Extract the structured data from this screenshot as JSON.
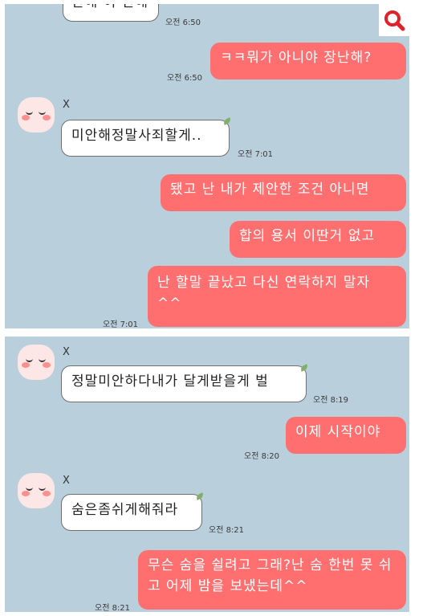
{
  "panel1": {
    "top_partial_message": "안해 이 안해",
    "top_partial_time": "오전 6:50",
    "msg1": {
      "text": "ㅋㅋ뭐가 아니야 장난해?",
      "time": "오전 6:50"
    },
    "sender": "X",
    "msg2": {
      "text": "미안해정말사죄할게..",
      "time": "오전 7:01"
    },
    "msg3": {
      "text": "됐고 난 내가 제안한 조건 아니면"
    },
    "msg4": {
      "text": "합의 용서 이딴거 없고"
    },
    "msg5": {
      "text": "난 할말 끝났고 다신 연락하지 말자 ^^",
      "time": "오전 7:01"
    }
  },
  "panel2": {
    "sender1": "X",
    "msg1": {
      "text": "정말미안하다내가 달게받을게 벌",
      "time": "오전 8:19"
    },
    "msg2": {
      "text": "이제 시작이야",
      "time": "오전 8:20"
    },
    "sender2": "X",
    "msg3": {
      "text": "숨은좀쉬게해줘라",
      "time": "오전 8:21"
    },
    "msg4": {
      "text": "무슨 숨을 쉴려고 그래?난 숨 한번 못 쉬고 어제 밤을 보냈는데^^",
      "time": "오전 8:21"
    }
  },
  "icons": {
    "search": "search-icon",
    "avatar": "peach-face-avatar-icon",
    "leaf": "leaf-icon"
  },
  "colors": {
    "chat_background": "#bacfdc",
    "outgoing_bubble": "#ff6f6f",
    "incoming_bubble": "#ffffff",
    "search_icon": "#e0202a"
  }
}
